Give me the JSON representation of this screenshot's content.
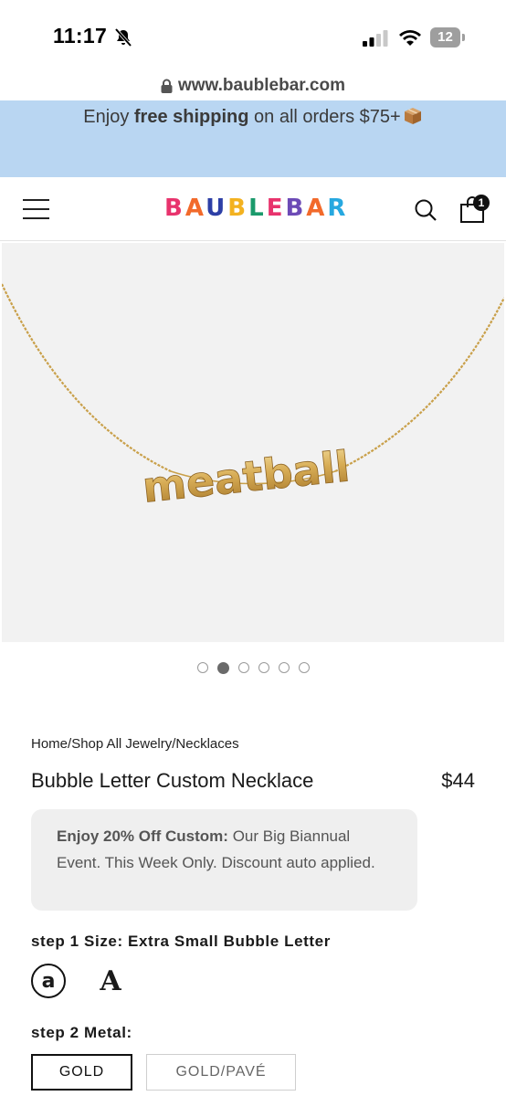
{
  "status_bar": {
    "time": "11:17",
    "battery": "12"
  },
  "browser": {
    "url": "www.baublebar.com"
  },
  "promo": {
    "prefix": "Enjoy ",
    "bold": "free shipping",
    "suffix": " on all orders $75+"
  },
  "header": {
    "logo_letters": [
      {
        "char": "B",
        "color": "#e8336d"
      },
      {
        "char": "A",
        "color": "#f26a2b"
      },
      {
        "char": "U",
        "color": "#2d3fa6"
      },
      {
        "char": "B",
        "color": "#f3b220"
      },
      {
        "char": "L",
        "color": "#1a9a6b"
      },
      {
        "char": "E",
        "color": "#e8336d"
      },
      {
        "char": "B",
        "color": "#6c4ab6"
      },
      {
        "char": "A",
        "color": "#f26a2b"
      },
      {
        "char": "R",
        "color": "#27a8e0"
      }
    ],
    "cart_count": "1"
  },
  "product_image": {
    "necklace_text": "meatball",
    "alt": "Bubble Letter Custom Necklace"
  },
  "carousel": {
    "count": 6,
    "active_index": 1
  },
  "breadcrumb": {
    "items": [
      "Home",
      "Shop All Jewelry",
      "Necklaces"
    ],
    "separator": "/"
  },
  "product": {
    "title": "Bubble Letter Custom Necklace",
    "price": "$44"
  },
  "discount": {
    "bold": "Enjoy 20% Off Custom:",
    "text": " Our Big Biannual Event. This Week Only. Discount auto applied."
  },
  "step1": {
    "num": "step 1",
    "label": " Size: Extra Small Bubble Letter",
    "options": [
      {
        "glyph": "a",
        "selected": true
      },
      {
        "glyph": "A",
        "selected": false
      }
    ]
  },
  "step2": {
    "num": "step 2",
    "label": " Metal:",
    "options": [
      {
        "label": "GOLD",
        "selected": true
      },
      {
        "label": "GOLD/PAVÉ",
        "selected": false
      }
    ]
  },
  "colors": {
    "promo_bg": "#b9d6f2",
    "step1_underline": "#27a8e0",
    "step2_underline": "#1b9e77",
    "gold": "#c9a04a"
  }
}
